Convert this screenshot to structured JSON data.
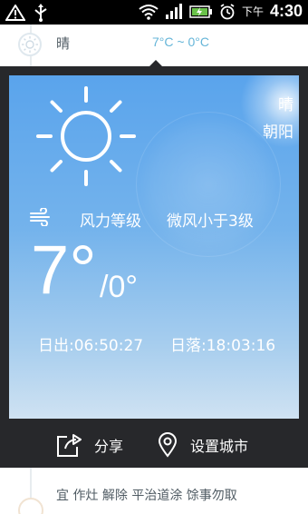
{
  "statusbar": {
    "ampm": "下午",
    "time": "4:30",
    "icons": [
      "warning-icon",
      "usb-icon",
      "wifi-icon",
      "signal-icon",
      "battery-charging-icon",
      "alarm-icon"
    ]
  },
  "top": {
    "condition": "晴",
    "temp_range": "7°C ~ 0°C",
    "icon": "sun-small-icon"
  },
  "card": {
    "condition": "晴",
    "city": "朝阳",
    "wind_label": "风力等级",
    "wind_value": "微风小于3级",
    "temp_high": "7°",
    "temp_low": "/0°",
    "sunrise": "日出:06:50:27",
    "sunset": "日落:18:03:16",
    "icon": "sun-icon"
  },
  "actions": {
    "share_label": "分享",
    "set_city_label": "设置城市"
  },
  "almanac": {
    "text": "宜  作灶 解除 平治道涂 馀事勿取"
  },
  "colors": {
    "panel": "#27282b",
    "accent": "#65b5d8",
    "sky_top": "#5aa4ec",
    "sky_bottom": "#cfe2f2"
  }
}
